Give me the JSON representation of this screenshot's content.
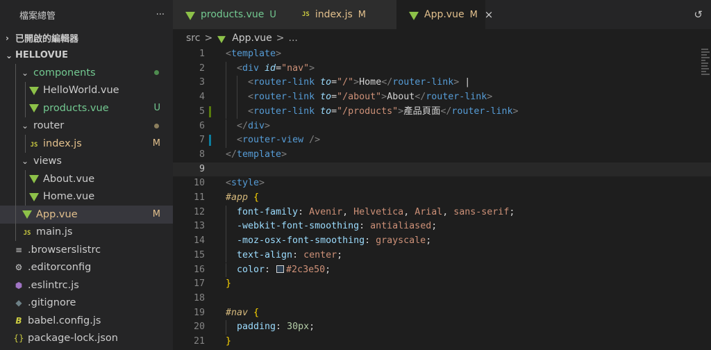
{
  "explorer": {
    "title": "檔案總管",
    "more": "···",
    "open_editors": "已開啟的編輯器",
    "project": "HELLOVUE",
    "tree": [
      {
        "label": "components",
        "kind": "folder",
        "depth": 1,
        "open": true,
        "color": "#73c991",
        "dot": "#4e8c4f"
      },
      {
        "label": "HelloWorld.vue",
        "kind": "vue",
        "depth": 2,
        "color": "#cccccc"
      },
      {
        "label": "products.vue",
        "kind": "vue",
        "depth": 2,
        "color": "#73c991",
        "status": "U",
        "status_color": "#73c991"
      },
      {
        "label": "router",
        "kind": "folder",
        "depth": 1,
        "open": true,
        "color": "#cccccc",
        "dot": "#8a7d5c"
      },
      {
        "label": "index.js",
        "kind": "js",
        "depth": 2,
        "color": "#e2c08d",
        "status": "M",
        "status_color": "#e2c08d"
      },
      {
        "label": "views",
        "kind": "folder",
        "depth": 1,
        "open": true,
        "color": "#cccccc"
      },
      {
        "label": "About.vue",
        "kind": "vue",
        "depth": 2,
        "color": "#cccccc"
      },
      {
        "label": "Home.vue",
        "kind": "vue",
        "depth": 2,
        "color": "#cccccc"
      },
      {
        "label": "App.vue",
        "kind": "vue",
        "depth": 1,
        "color": "#e2c08d",
        "status": "M",
        "status_color": "#e2c08d",
        "selected": true
      },
      {
        "label": "main.js",
        "kind": "js",
        "depth": 1,
        "color": "#cccccc"
      },
      {
        "label": ".browserslistrc",
        "kind": "lines",
        "depth": 0,
        "color": "#cccccc"
      },
      {
        "label": ".editorconfig",
        "kind": "gear",
        "depth": 0,
        "color": "#cccccc"
      },
      {
        "label": ".eslintrc.js",
        "kind": "eslint",
        "depth": 0,
        "color": "#cccccc"
      },
      {
        "label": ".gitignore",
        "kind": "git",
        "depth": 0,
        "color": "#cccccc"
      },
      {
        "label": "babel.config.js",
        "kind": "babel",
        "depth": 0,
        "color": "#cccccc"
      },
      {
        "label": "package-lock.json",
        "kind": "json",
        "depth": 0,
        "color": "#cccccc"
      }
    ]
  },
  "tabs": [
    {
      "label": "products.vue",
      "status": "U",
      "kind": "vue",
      "color": "#73c991",
      "status_color": "#73c991"
    },
    {
      "label": "index.js",
      "status": "M",
      "kind": "js",
      "color": "#e2c08d",
      "status_color": "#e2c08d"
    },
    {
      "label": "App.vue",
      "status": "M",
      "kind": "vue",
      "color": "#e2c08d",
      "status_color": "#e2c08d",
      "active": true,
      "close": "×"
    }
  ],
  "breadcrumb": {
    "folder": "src",
    "sep": ">",
    "file": "App.vue",
    "tail": "..."
  },
  "editor": {
    "current_line": 9,
    "lines": [
      {
        "n": "1",
        "indent": 0,
        "tokens": [
          [
            "punc",
            "<"
          ],
          [
            "tag",
            "template"
          ],
          [
            "punc",
            ">"
          ]
        ]
      },
      {
        "n": "2",
        "indent": 1,
        "tokens": [
          [
            "punc",
            "<"
          ],
          [
            "tag",
            "div "
          ],
          [
            "attr",
            "id"
          ],
          [
            "text",
            "="
          ],
          [
            "str",
            "\"nav\""
          ],
          [
            "punc",
            ">"
          ]
        ]
      },
      {
        "n": "3",
        "indent": 2,
        "tokens": [
          [
            "punc",
            "<"
          ],
          [
            "tag",
            "router-link "
          ],
          [
            "attr",
            "to"
          ],
          [
            "text",
            "="
          ],
          [
            "str",
            "\"/\""
          ],
          [
            "punc",
            ">"
          ],
          [
            "text",
            "Home"
          ],
          [
            "punc",
            "</"
          ],
          [
            "tag",
            "router-link"
          ],
          [
            "punc",
            ">"
          ],
          [
            "text",
            " |"
          ]
        ]
      },
      {
        "n": "4",
        "indent": 2,
        "tokens": [
          [
            "punc",
            "<"
          ],
          [
            "tag",
            "router-link "
          ],
          [
            "attr",
            "to"
          ],
          [
            "text",
            "="
          ],
          [
            "str",
            "\"/about\""
          ],
          [
            "punc",
            ">"
          ],
          [
            "text",
            "About"
          ],
          [
            "punc",
            "</"
          ],
          [
            "tag",
            "router-link"
          ],
          [
            "punc",
            ">"
          ]
        ]
      },
      {
        "n": "5",
        "indent": 2,
        "mark": "#587c0c",
        "tokens": [
          [
            "punc",
            "<"
          ],
          [
            "tag",
            "router-link "
          ],
          [
            "attr",
            "to"
          ],
          [
            "text",
            "="
          ],
          [
            "str",
            "\"/products\""
          ],
          [
            "punc",
            ">"
          ],
          [
            "text",
            "產品頁面"
          ],
          [
            "punc",
            "</"
          ],
          [
            "tag",
            "router-link"
          ],
          [
            "punc",
            ">"
          ]
        ]
      },
      {
        "n": "6",
        "indent": 1,
        "tokens": [
          [
            "punc",
            "</"
          ],
          [
            "tag",
            "div"
          ],
          [
            "punc",
            ">"
          ]
        ]
      },
      {
        "n": "7",
        "indent": 1,
        "mark": "#0c7d9d",
        "tokens": [
          [
            "punc",
            "<"
          ],
          [
            "tag",
            "router-view "
          ],
          [
            "punc",
            "/>"
          ]
        ]
      },
      {
        "n": "8",
        "indent": 0,
        "tokens": [
          [
            "punc",
            "</"
          ],
          [
            "tag",
            "template"
          ],
          [
            "punc",
            ">"
          ]
        ]
      },
      {
        "n": "9",
        "indent": 0,
        "tokens": []
      },
      {
        "n": "10",
        "indent": 0,
        "tokens": [
          [
            "punc",
            "<"
          ],
          [
            "tag",
            "style"
          ],
          [
            "punc",
            ">"
          ]
        ]
      },
      {
        "n": "11",
        "indent": 0,
        "tokens": [
          [
            "sel",
            "#app "
          ],
          [
            "brace",
            "{"
          ]
        ]
      },
      {
        "n": "12",
        "indent": 1,
        "tokens": [
          [
            "prop",
            "font-family"
          ],
          [
            "text",
            ": "
          ],
          [
            "val",
            "Avenir"
          ],
          [
            "text",
            ", "
          ],
          [
            "val",
            "Helvetica"
          ],
          [
            "text",
            ", "
          ],
          [
            "val",
            "Arial"
          ],
          [
            "text",
            ", "
          ],
          [
            "val",
            "sans-serif"
          ],
          [
            "text",
            ";"
          ]
        ]
      },
      {
        "n": "13",
        "indent": 1,
        "tokens": [
          [
            "prop",
            "-webkit-font-smoothing"
          ],
          [
            "text",
            ": "
          ],
          [
            "val",
            "antialiased"
          ],
          [
            "text",
            ";"
          ]
        ]
      },
      {
        "n": "14",
        "indent": 1,
        "tokens": [
          [
            "prop",
            "-moz-osx-font-smoothing"
          ],
          [
            "text",
            ": "
          ],
          [
            "val",
            "grayscale"
          ],
          [
            "text",
            ";"
          ]
        ]
      },
      {
        "n": "15",
        "indent": 1,
        "tokens": [
          [
            "prop",
            "text-align"
          ],
          [
            "text",
            ": "
          ],
          [
            "val",
            "center"
          ],
          [
            "text",
            ";"
          ]
        ]
      },
      {
        "n": "16",
        "indent": 1,
        "tokens": [
          [
            "prop",
            "color"
          ],
          [
            "text",
            ": "
          ],
          [
            "swatch",
            "#2c3e50"
          ],
          [
            "val",
            "#2c3e50"
          ],
          [
            "text",
            ";"
          ]
        ]
      },
      {
        "n": "17",
        "indent": 0,
        "tokens": [
          [
            "brace",
            "}"
          ]
        ]
      },
      {
        "n": "18",
        "indent": 0,
        "tokens": []
      },
      {
        "n": "19",
        "indent": 0,
        "tokens": [
          [
            "sel",
            "#nav "
          ],
          [
            "brace",
            "{"
          ]
        ]
      },
      {
        "n": "20",
        "indent": 1,
        "tokens": [
          [
            "prop",
            "padding"
          ],
          [
            "text",
            ": "
          ],
          [
            "num",
            "30px"
          ],
          [
            "text",
            ";"
          ]
        ]
      },
      {
        "n": "21",
        "indent": 0,
        "tokens": [
          [
            "brace",
            "}"
          ]
        ]
      }
    ]
  }
}
